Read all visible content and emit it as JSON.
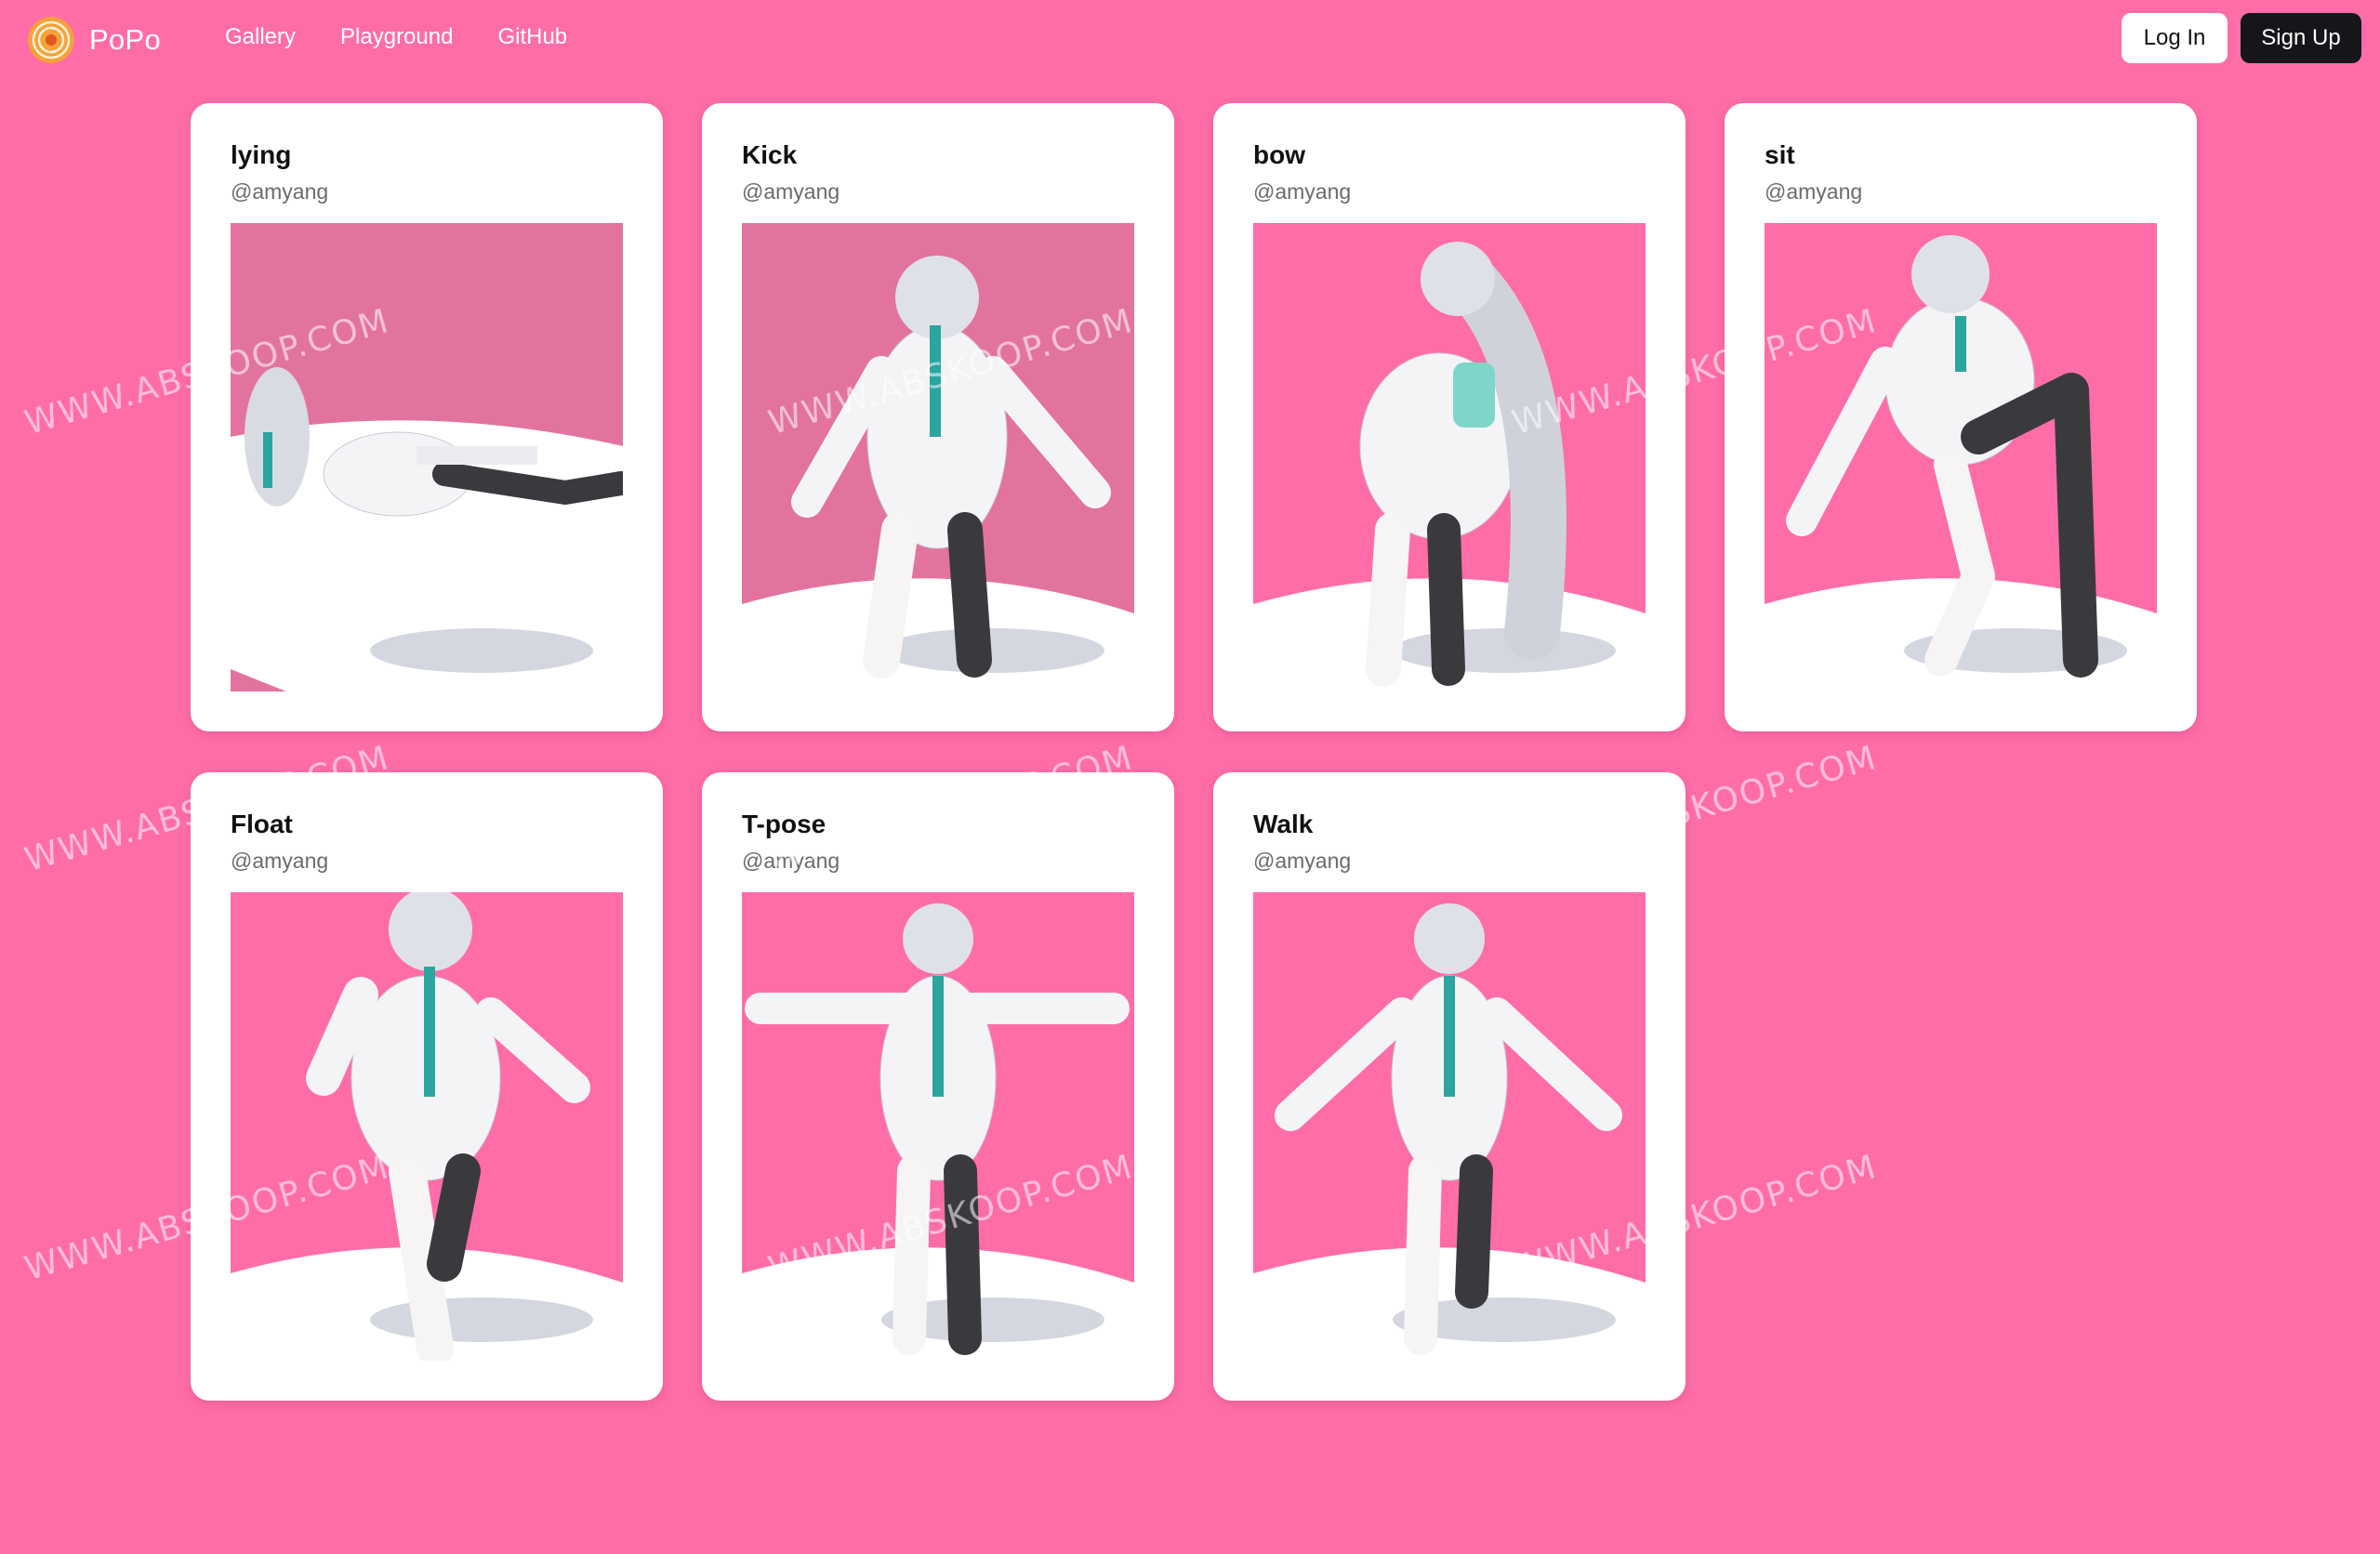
{
  "header": {
    "brand": "PoPo",
    "nav": [
      "Gallery",
      "Playground",
      "GitHub"
    ],
    "login_label": "Log In",
    "signup_label": "Sign Up"
  },
  "colors": {
    "page_background": "#ff6da8",
    "thumb_pink": "#ff6da8",
    "thumb_pink_muted": "#e2739f",
    "card": "#ffffff",
    "signup_button": "#16161a"
  },
  "cards": [
    {
      "title": "lying",
      "author": "@amyang",
      "pose": "lying"
    },
    {
      "title": "Kick",
      "author": "@amyang",
      "pose": "kick"
    },
    {
      "title": "bow",
      "author": "@amyang",
      "pose": "bow"
    },
    {
      "title": "sit",
      "author": "@amyang",
      "pose": "sit"
    },
    {
      "title": "Float",
      "author": "@amyang",
      "pose": "float"
    },
    {
      "title": "T-pose",
      "author": "@amyang",
      "pose": "tpose"
    },
    {
      "title": "Walk",
      "author": "@amyang",
      "pose": "walk"
    }
  ],
  "watermark_text": "WWW.ABSKOOP.COM"
}
